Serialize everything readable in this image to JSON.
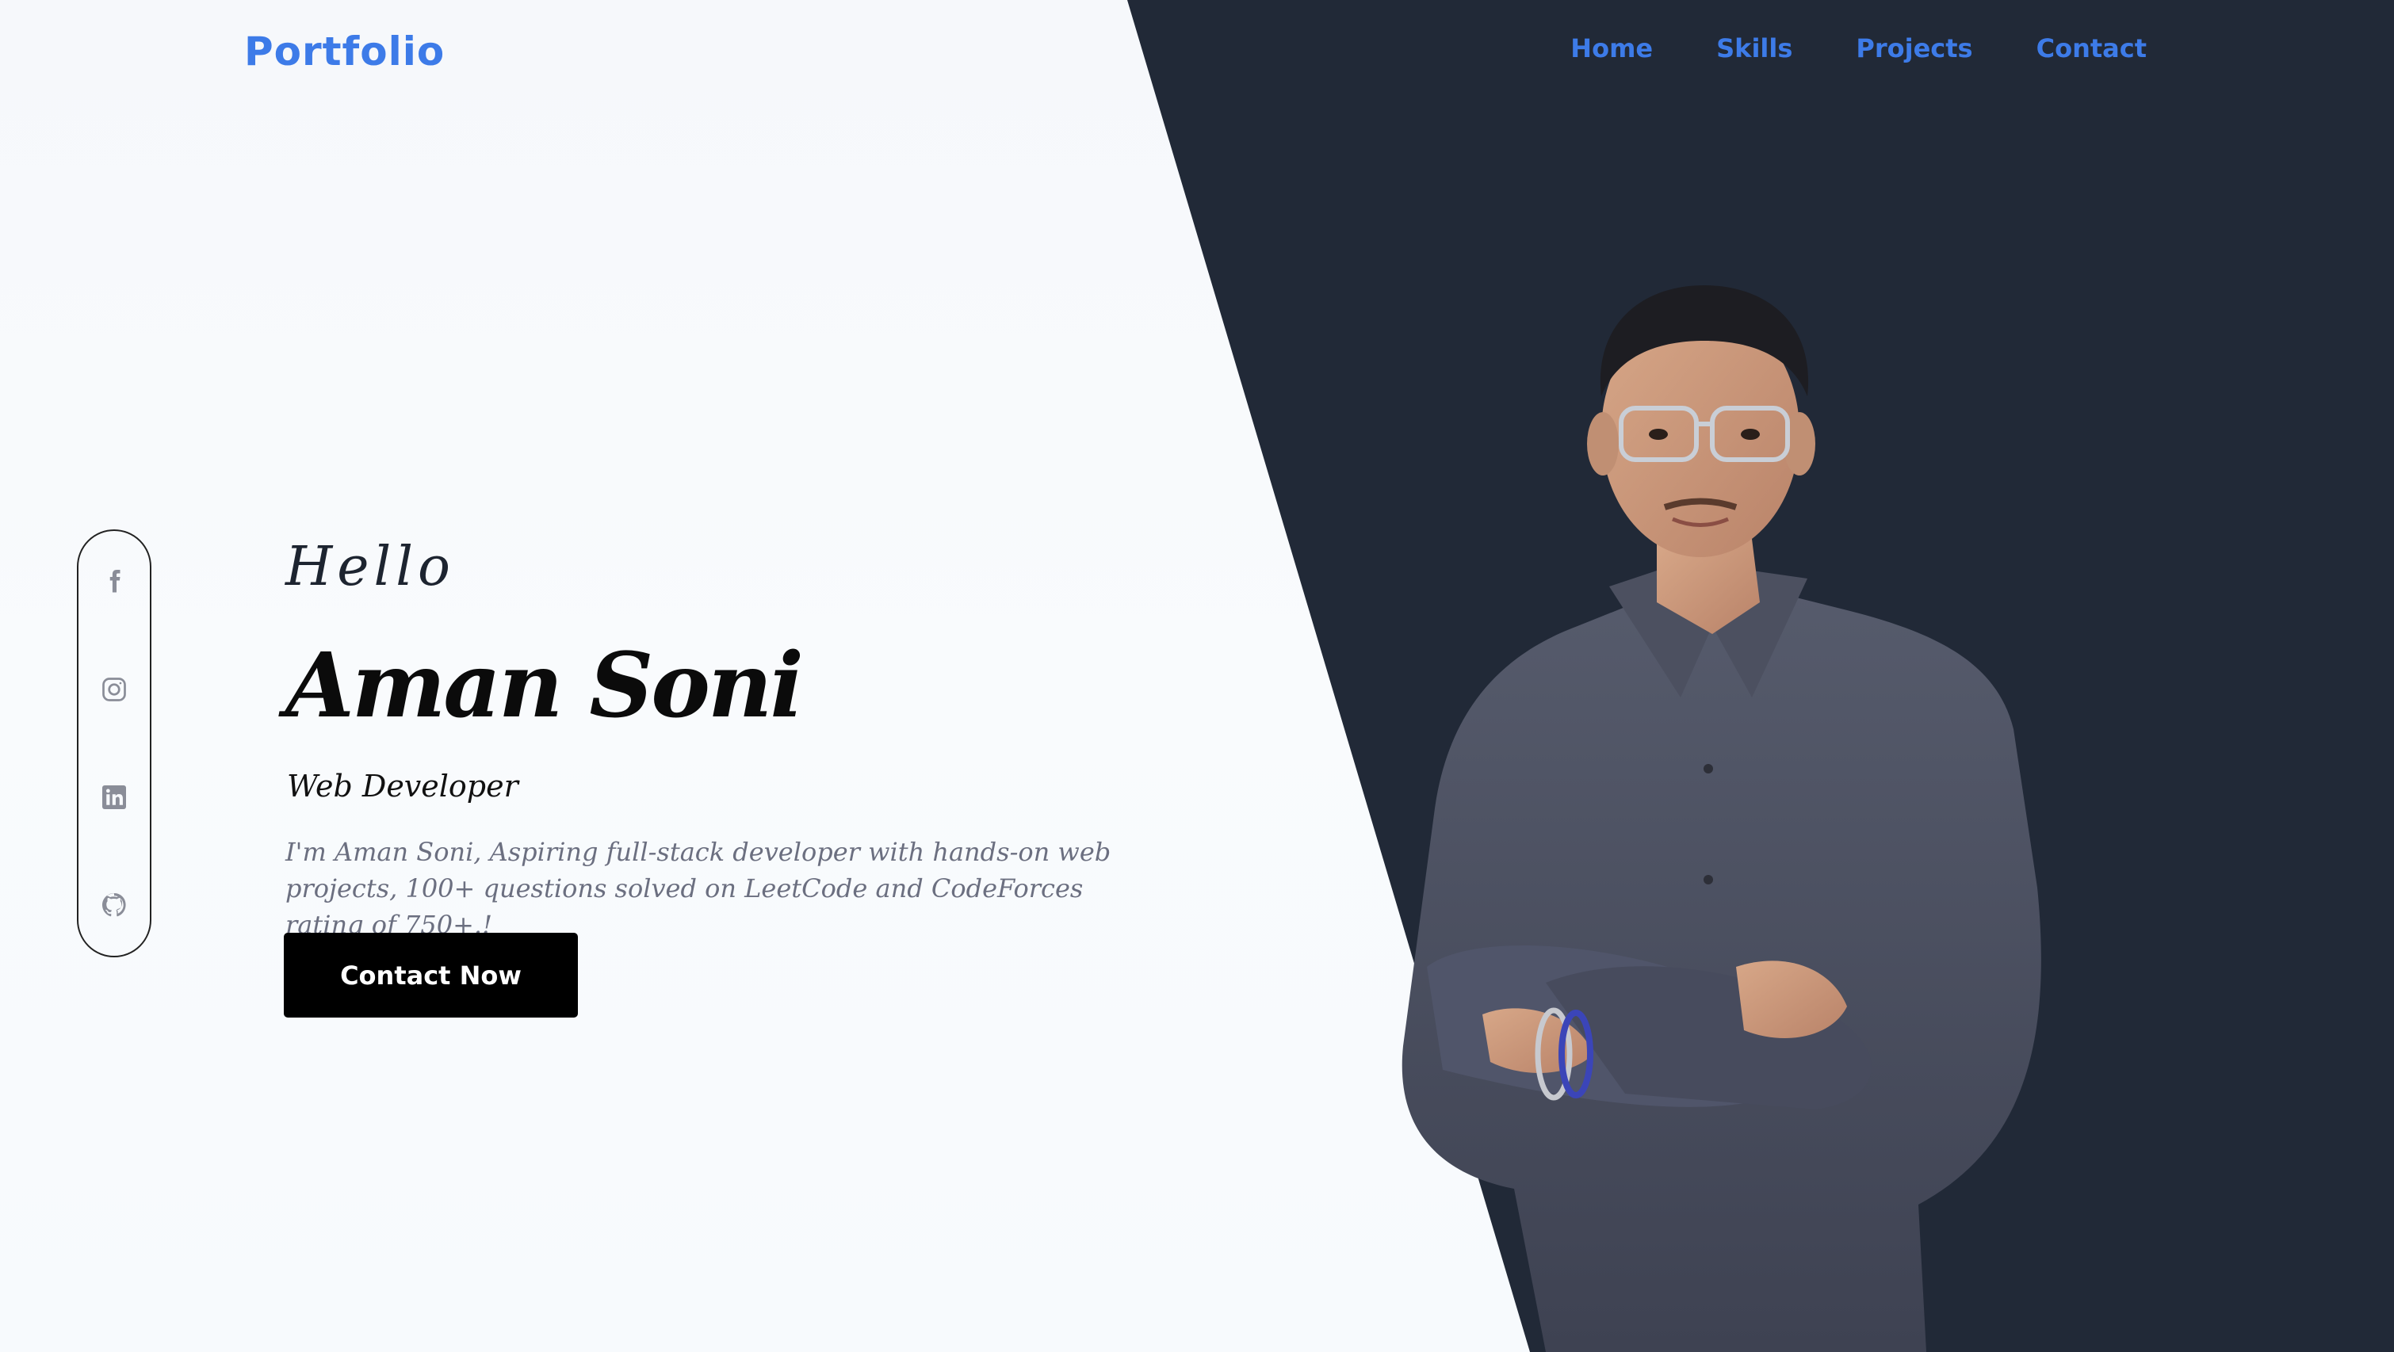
{
  "nav": {
    "logo": "Portfolio",
    "links": [
      "Home",
      "Skills",
      "Projects",
      "Contact"
    ]
  },
  "social": [
    "facebook-icon",
    "instagram-icon",
    "linkedin-icon",
    "github-icon"
  ],
  "hero": {
    "greeting": "Hello",
    "name": "Aman Soni",
    "role": "Web Developer",
    "bio": "I'm Aman Soni, Aspiring full-stack developer with hands-on web projects, 100+ questions solved on LeetCode and CodeForces rating of 750+.!",
    "cta": "Contact Now"
  },
  "colors": {
    "accent": "#3d7be8",
    "dark_panel": "#212937",
    "light_bg": "#f7f9fc",
    "button": "#000000"
  }
}
